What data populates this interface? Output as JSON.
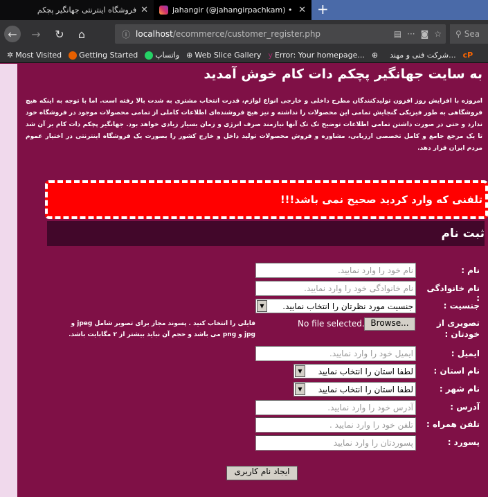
{
  "browser": {
    "tabs": [
      {
        "title": "فروشگاه اینترنتی جهانگیر پچکم",
        "active": false
      },
      {
        "title": "jahangir (@jahangirpachkam) • Ins",
        "active": true
      }
    ],
    "new_tab": "+",
    "url_host": "localhost",
    "url_path": "/ecommerce/customer_register.php",
    "search_placeholder": "Sea",
    "bookmarks": [
      "Most Visited",
      "Getting Started",
      "واتساپ",
      "Web Slice Gallery",
      "Error: Your homepage...",
      "شرکت فنی و مهند..."
    ]
  },
  "page": {
    "welcome": "به سایت جهانگیر پچکم دات کام خوش آمدید",
    "intro": "امروزه با افزایش روز افزون تولیدکنندگان مطرح داخلی و خارجی انواع لوازم، قدرت انتخاب مشتری به شدت بالا رفته است. اما با توجه به اینکه هیچ فروشگاهی به طور فیزیکی گنجایش تمامی این محصولات را نداشته و نیز هیچ فروشنده‌ای اطلاعات کاملی از تمامی محصولات موجود در فروشگاه خود ندارد و حتی در صورت داشتن تمامی اطلاعات توضیح تک تک آنها نیازمند صرف انرژی و زمان بسیار زیادی خواهد بود. جهانگیر پچکم دات کام بر آن شد تا یک مرجع جامع و کامل تخصصی ارزیابی، مشاوره و فروش محصولات تولید داخل و خارج کشور را بصورت یک فروشگاه اینترنتی در اختیار عموم مردم ایران قرار دهد.",
    "error": "تلفنی که وارد کردید صحیح نمی باشد!!!",
    "register_title": "ثبت نام",
    "colors": {
      "background": "#7f1046",
      "header_bar": "#42072a",
      "error": "#ff0000",
      "side_strip": "#f0d9ec"
    }
  },
  "form": {
    "name": {
      "label": "نام :",
      "placeholder": "نام خود را وارد نمایید."
    },
    "family": {
      "label": "نام خانوادگی :",
      "placeholder": "نام خانوادگی خود را وارد نمایید."
    },
    "gender": {
      "label": "جنسیت :",
      "value": "جنسیت مورد نظرتان را انتخاب نمایید."
    },
    "image": {
      "label": "تصویری از خودتان :",
      "browse": "Browse...",
      "status": "No file selected.",
      "hint": "فایلی را انتخاب کنید . پسوند مجاز برای تصویر شامل jpeg و jpg و png می باشد و حجم آن نباید بیشتر از ۲ مگابایت باشد."
    },
    "email": {
      "label": "ایمیل :",
      "placeholder": "ایمیل خود را وارد نمایید."
    },
    "state": {
      "label": "نام استان :",
      "value": "لطفا استان را انتخاب نمایید"
    },
    "city": {
      "label": "نام شهر :",
      "value": "لطفا استان را انتخاب نمایید"
    },
    "address": {
      "label": "آدرس :",
      "placeholder": "آدرس خود را وارد نمایید."
    },
    "phone": {
      "label": "تلفن همراه :",
      "placeholder": "تلفن خود را وارد نمایید ."
    },
    "password": {
      "label": "پسورد :",
      "placeholder": "پسوردتان را وارد نمایید"
    },
    "submit": "ایجاد نام کاربری"
  }
}
